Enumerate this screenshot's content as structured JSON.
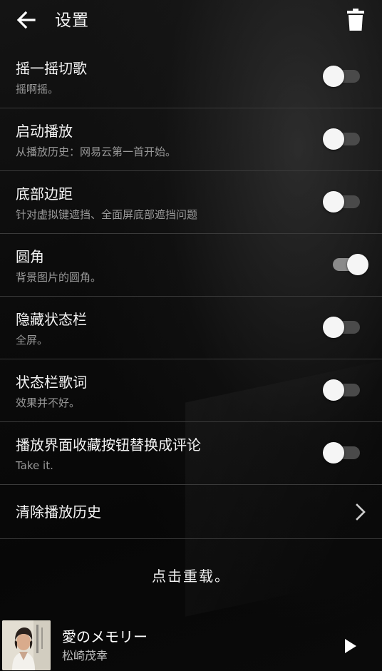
{
  "header": {
    "title": "设置",
    "back_icon": "arrow-left-icon",
    "delete_icon": "trash-icon"
  },
  "settings": [
    {
      "title": "摇一摇切歌",
      "subtitle": "摇啊摇。",
      "enabled": false
    },
    {
      "title": "启动播放",
      "subtitle": "从播放历史：网易云第一首开始。",
      "enabled": false
    },
    {
      "title": "底部边距",
      "subtitle": "针对虚拟键遮挡、全面屏底部遮挡问题",
      "enabled": false
    },
    {
      "title": "圆角",
      "subtitle": "背景图片的圆角。",
      "enabled": true
    },
    {
      "title": "隐藏状态栏",
      "subtitle": "全屏。",
      "enabled": false
    },
    {
      "title": "状态栏歌词",
      "subtitle": "效果并不好。",
      "enabled": false
    },
    {
      "title": "播放界面收藏按钮替换成评论",
      "subtitle": "Take it.",
      "enabled": false
    }
  ],
  "clear_history": {
    "label": "清除播放历史",
    "icon": "chevron-right-icon"
  },
  "reload_text": "点击重载。",
  "player": {
    "song_title": "愛のメモリー",
    "artist": "松崎茂幸",
    "play_icon": "play-icon"
  },
  "colors": {
    "background": "#050505",
    "divider": "#3a3a3a",
    "subtitle": "#9a9a9a",
    "toggle_track_off": "#4a4a4a",
    "toggle_track_on": "#8a8a8a",
    "toggle_thumb": "#f5f5f5"
  }
}
